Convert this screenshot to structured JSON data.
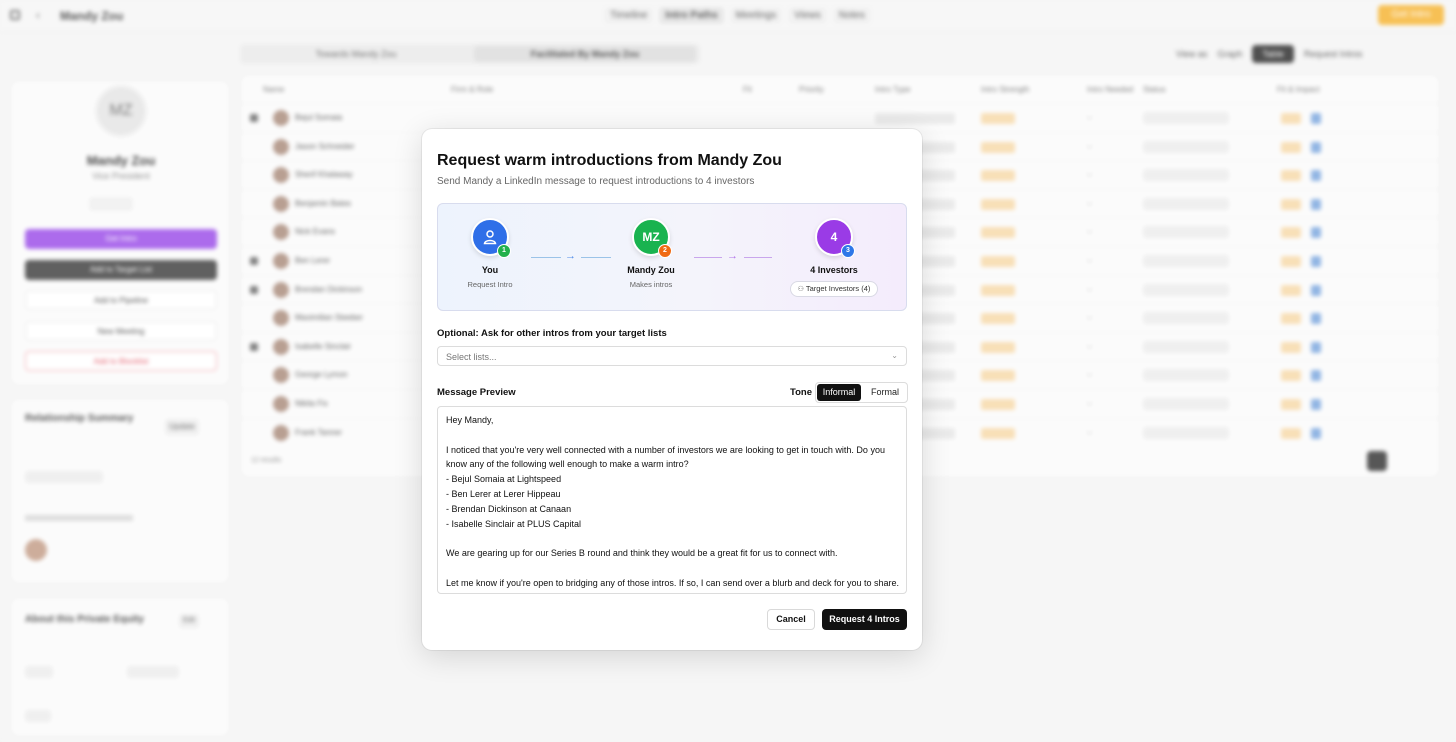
{
  "background": {
    "breadcrumb": "Mandy Zou",
    "tabs": [
      "Timeline",
      "Intro Paths",
      "Meetings",
      "Views",
      "Notes"
    ],
    "top_button": "Get Intro",
    "profile": {
      "initials": "MZ",
      "name": "Mandy Zou",
      "role": "Vice President",
      "buttons": [
        "Get Intro",
        "Add to Target List",
        "Add to Pipeline",
        "New Meeting",
        "Add to Blocklist"
      ]
    },
    "relationship": {
      "title": "Relationship Summary",
      "action": "Update"
    },
    "about": {
      "title": "About this Private Equity",
      "action": "Edit"
    },
    "segments": [
      "Towards Mandy Zou",
      "Facilitated By Mandy Zou"
    ],
    "toolbar": [
      "View as",
      "Graph",
      "Table",
      "Request Intros"
    ],
    "table_headers": [
      "Name",
      "Firm & Role",
      "Fit",
      "Priority",
      "Intro Type",
      "Intro Strength",
      "Intro Needed",
      "Status",
      "Fit & Impact"
    ],
    "row_names": [
      "Bejul Somaia",
      "Jason Schneider",
      "Sherif Khalaway",
      "Benjamin Bates",
      "Nick Evans",
      "Ben Lerer",
      "Brendan Dickinson",
      "Maximilian Steeber",
      "Isabelle Sinclair",
      "George Lymon",
      "Nikita Fix",
      "Frank Tanner"
    ],
    "footer": "12 results"
  },
  "modal": {
    "title": "Request warm introductions from Mandy Zou",
    "subtitle": "Send Mandy a LinkedIn message to request introductions to 4 investors",
    "flow": {
      "nodes": [
        {
          "avatar_text": "",
          "icon": "user-icon",
          "badge": "1",
          "label": "You",
          "sub": "Request Intro",
          "color": "#2f6fe8"
        },
        {
          "avatar_text": "MZ",
          "badge": "2",
          "label": "Mandy Zou",
          "sub": "Makes intros",
          "color": "#19b34f"
        },
        {
          "avatar_text": "4",
          "badge": "3",
          "label": "4 Investors",
          "sub": "",
          "color": "#9a3be6"
        }
      ],
      "target_button": "Target Investors (4)"
    },
    "optional_label": "Optional: Ask for other intros from your target lists",
    "select_placeholder": "Select lists...",
    "preview_label": "Message Preview",
    "tone_label": "Tone",
    "tone_options": [
      "Informal",
      "Formal"
    ],
    "tone_selected": "Informal",
    "message_lines": [
      "Hey Mandy,",
      "",
      "I noticed that you're very well connected with a number of investors we are looking to get in touch with. Do you",
      "know any of the following well enough to make a warm intro?",
      "- Bejul Somaia at Lightspeed",
      "- Ben Lerer at Lerer Hippeau",
      "- Brendan Dickinson at Canaan",
      "- Isabelle Sinclair at PLUS Capital",
      "",
      "We are gearing up for our Series B round and think they would be a great fit for us to connect with.",
      "",
      "Let me know if you're open to bridging any of those intros. If so, I can send over a blurb and deck for you to share."
    ],
    "cancel_label": "Cancel",
    "submit_label": "Request 4 Intros"
  }
}
